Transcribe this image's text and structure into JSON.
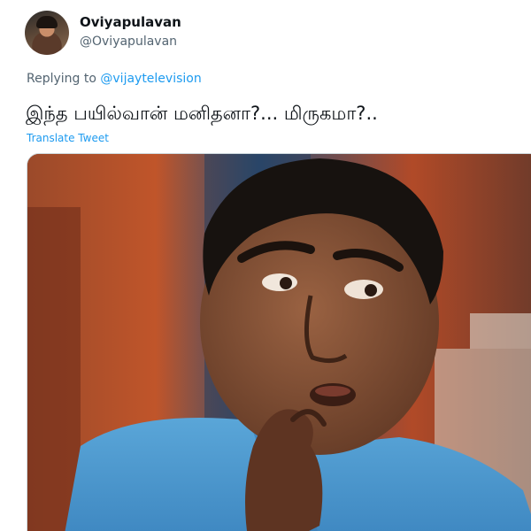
{
  "author": {
    "display_name": "Oviyapulavan",
    "handle": "@Oviyapulavan",
    "avatar_icon": "profile-photo"
  },
  "reply": {
    "prefix": "Replying to",
    "mention": "@vijaytelevision"
  },
  "tweet": {
    "text": "இந்த பயில்வான் மனிதனா?... மிருகமா?..",
    "translate_label": "Translate Tweet"
  },
  "media": {
    "kind": "photo",
    "icon": "meme-photo"
  },
  "colors": {
    "link": "#1d9bf0",
    "secondary_text": "#536471",
    "primary_text": "#0f1419"
  }
}
